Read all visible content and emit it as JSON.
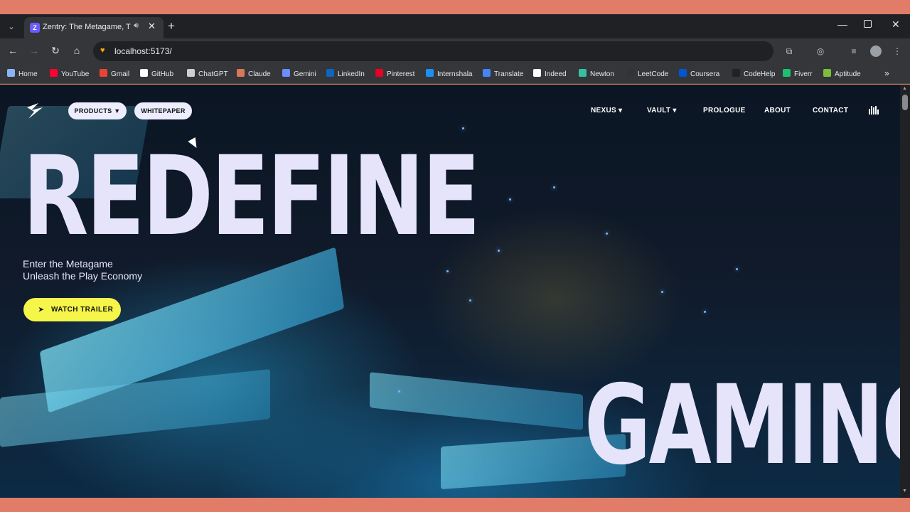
{
  "browser": {
    "tab": {
      "title": "Zentry: The Metagame, The",
      "favicon": "Z"
    },
    "address": {
      "url": "localhost:5173/"
    },
    "bookmarks": [
      {
        "label": "Home",
        "color": "#8ab4f8"
      },
      {
        "label": "YouTube",
        "color": "#ff0033"
      },
      {
        "label": "Gmail",
        "color": "#ea4335"
      },
      {
        "label": "GitHub",
        "color": "#ffffff"
      },
      {
        "label": "ChatGPT",
        "color": "#cfcfcf"
      },
      {
        "label": "Claude",
        "color": "#d97757"
      },
      {
        "label": "Gemini",
        "color": "#6c8cff"
      },
      {
        "label": "LinkedIn",
        "color": "#0a66c2"
      },
      {
        "label": "Pinterest",
        "color": "#e60023"
      },
      {
        "label": "Internshala",
        "color": "#1d8ff2"
      },
      {
        "label": "Translate",
        "color": "#4285f4"
      },
      {
        "label": "Indeed",
        "color": "#ffffff"
      },
      {
        "label": "Newton",
        "color": "#34c1a0"
      },
      {
        "label": "LeetCode",
        "color": "#333333"
      },
      {
        "label": "Coursera",
        "color": "#0056d2"
      },
      {
        "label": "CodeHelp",
        "color": "#222222"
      },
      {
        "label": "Fiverr",
        "color": "#1dbf73"
      },
      {
        "label": "Aptitude",
        "color": "#7cbf3a"
      }
    ]
  },
  "site": {
    "nav_left": {
      "products": "PRODUCTS ▼",
      "whitepaper": "WHITEPAPER"
    },
    "nav_right": [
      "NEXUS ▾",
      "VAULT ▾",
      "PROLOGUE",
      "ABOUT",
      "CONTACT"
    ],
    "hero": {
      "headline_top": "REDEFINE",
      "headline_bottom": "GAMING",
      "tagline_line1": "Enter the Metagame",
      "tagline_line2": "Unleash the Play Economy",
      "cta": "WATCH TRAILER"
    }
  },
  "colors": {
    "accent": "#f5f54a",
    "hero_text": "#e5e4fb",
    "pill": "#ededff"
  }
}
